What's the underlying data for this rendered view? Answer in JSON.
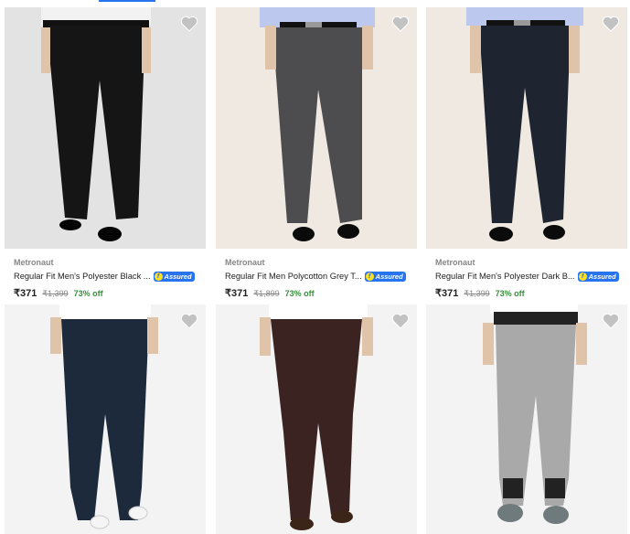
{
  "products": [
    {
      "brand": "Metronaut",
      "title": "Regular Fit Men's Polyester Black ...",
      "assured": "Assured",
      "price": "₹371",
      "mrp": "₹1,399",
      "discount": "73% off",
      "image": "black-formal-trousers",
      "bg": "#e3e3e3",
      "pant": "#151515",
      "shirt": "#f2f2f2"
    },
    {
      "brand": "Metronaut",
      "title": "Regular Fit Men Polycotton Grey T...",
      "assured": "Assured",
      "price": "₹371",
      "mrp": "₹1,899",
      "discount": "73% off",
      "image": "grey-formal-trousers",
      "bg": "#efe9e2",
      "pant": "#4d4d4f",
      "shirt": "#bcc8ee"
    },
    {
      "brand": "Metronaut",
      "title": "Regular Fit Men's Polyester Dark B...",
      "assured": "Assured",
      "price": "₹371",
      "mrp": "₹1,399",
      "discount": "73% off",
      "image": "dark-blue-formal-trousers",
      "bg": "#efe9e2",
      "pant": "#1e2430",
      "shirt": "#bcc8ee"
    },
    {
      "image": "navy-trousers",
      "bg": "#f3f3f3",
      "pant": "#1d2a3b",
      "shirt": "#ffffff"
    },
    {
      "image": "brown-trousers",
      "bg": "#f3f3f3",
      "pant": "#3a2321",
      "shirt": "#ffffff"
    },
    {
      "image": "grey-joggers",
      "bg": "#f3f3f3",
      "pant": "#a9a9a9",
      "shirt": "#ffffff"
    }
  ],
  "colors": {
    "assured": "#2874f0",
    "discount": "#388e3c",
    "muted": "#878787",
    "heart": "#c2c2c2"
  }
}
